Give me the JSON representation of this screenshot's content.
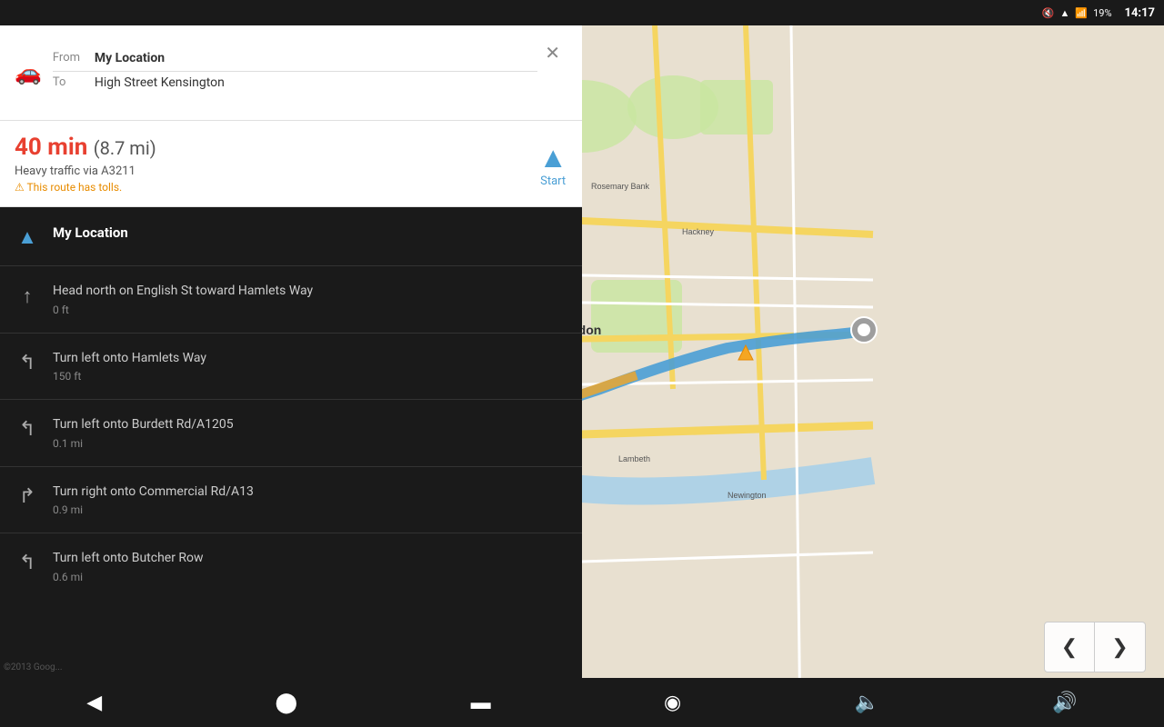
{
  "statusBar": {
    "time": "14:17",
    "battery": "19%",
    "icons": [
      "mute",
      "wifi",
      "signal",
      "battery"
    ]
  },
  "routeHeader": {
    "fromLabel": "From",
    "fromValue": "My Location",
    "toLabel": "To",
    "toValue": "High Street Kensington",
    "closeLabel": "✕"
  },
  "routeSummary": {
    "duration": "40 min",
    "distance": "(8.7 mi)",
    "via": "Heavy traffic via A3211",
    "tolls": "This route has tolls.",
    "startLabel": "Start"
  },
  "directions": [
    {
      "icon": "▲",
      "iconType": "blue",
      "main": "My Location",
      "dist": "",
      "isFirst": true
    },
    {
      "icon": "↑",
      "iconType": "grey",
      "main": "Head north on English St toward Hamlets Way",
      "dist": "0 ft",
      "isFirst": false
    },
    {
      "icon": "↰",
      "iconType": "grey",
      "main": "Turn left onto Hamlets Way",
      "dist": "150 ft",
      "isFirst": false
    },
    {
      "icon": "↰",
      "iconType": "grey",
      "main": "Turn left onto Burdett Rd/A1205",
      "dist": "0.1 mi",
      "isFirst": false
    },
    {
      "icon": "↱",
      "iconType": "grey",
      "main": "Turn right onto Commercial Rd/A13",
      "dist": "0.9 mi",
      "isFirst": false
    },
    {
      "icon": "↰",
      "iconType": "grey",
      "main": "Turn left onto Butcher Row",
      "dist": "0.6 mi",
      "isFirst": false
    }
  ],
  "mapControls": {
    "prevLabel": "❮",
    "nextLabel": "❯"
  },
  "bottomNav": {
    "back": "◀",
    "home": "⬤",
    "recents": "▬",
    "camera": "◉",
    "volDown": "🔈",
    "volUp": "🔊"
  },
  "copyright": "©2013 Goog..."
}
